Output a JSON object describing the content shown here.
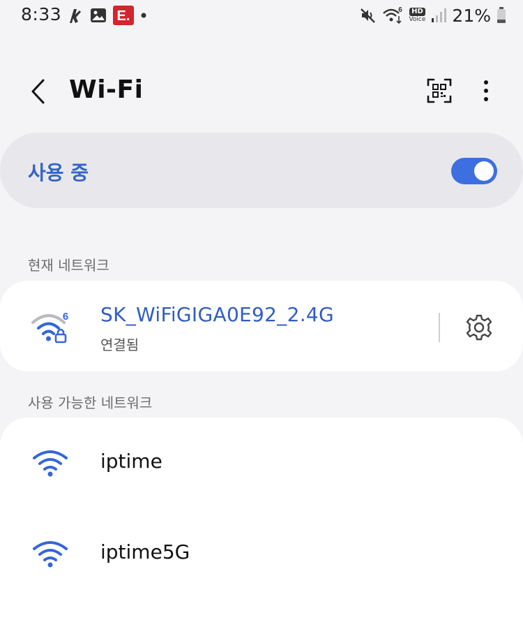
{
  "status_bar": {
    "time": "8:33",
    "left_icons": [
      "gesture-app-icon",
      "gallery-icon",
      "app-notification-icon",
      "more-notifications-dot"
    ],
    "right_icons": [
      "mute-icon",
      "wifi-6-icon",
      "hd-voice-icon",
      "cell-signal-icon",
      "battery-icon"
    ],
    "hd_label": "HD",
    "voice_label": "Voice",
    "battery_percent": "21%",
    "notification_badge_text": "E."
  },
  "header": {
    "title": "Wi-Fi",
    "back_icon": "chevron-left-icon",
    "qr_icon": "qr-scan-icon",
    "more_icon": "more-vertical-icon"
  },
  "master_toggle": {
    "label": "사용 중",
    "enabled": true,
    "accent": "#3d6fe0",
    "label_color": "#3563c8"
  },
  "current_section": {
    "label": "현재 네트워크",
    "network": {
      "name": "SK_WiFiGIGA0E92_2.4G",
      "status": "연결됨",
      "wifi_standard": "6",
      "secured": true,
      "settings_icon": "gear-icon"
    }
  },
  "available_section": {
    "label": "사용 가능한 네트워크",
    "networks": [
      {
        "name": "iptime",
        "icon": "wifi-icon"
      },
      {
        "name": "iptime5G",
        "icon": "wifi-icon"
      }
    ]
  },
  "colors": {
    "background": "#f4f4f6",
    "card": "#ffffff",
    "master_card": "#e8e8ec",
    "link_blue": "#2f5cc4",
    "wifi_blue": "#3366dd"
  }
}
